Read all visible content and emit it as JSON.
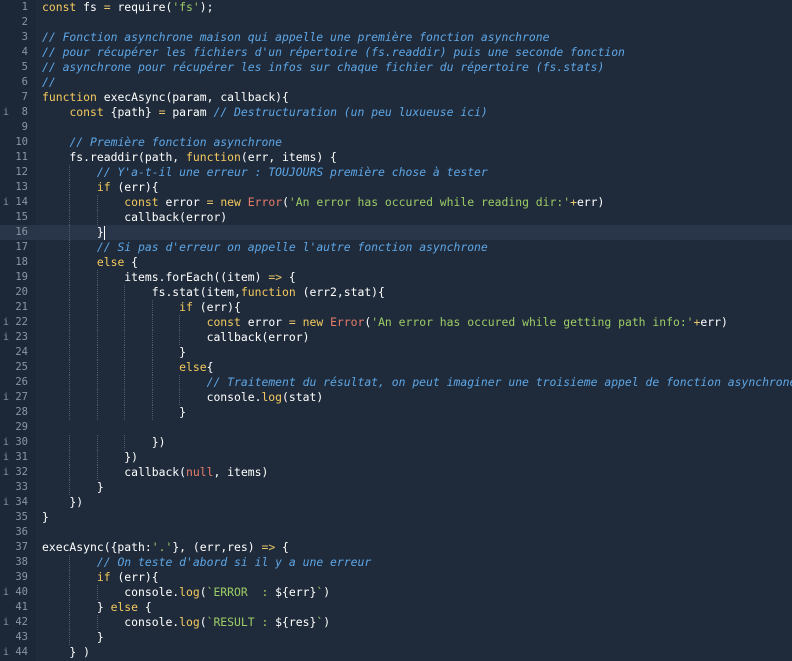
{
  "editor": {
    "active_line": 16,
    "lines": [
      {
        "n": "1",
        "m": "",
        "tokens": [
          {
            "t": "kw",
            "v": "const"
          },
          {
            "t": "plain",
            "v": " fs "
          },
          {
            "t": "op",
            "v": "="
          },
          {
            "t": "plain",
            "v": " require("
          },
          {
            "t": "str",
            "v": "'fs'"
          },
          {
            "t": "plain",
            "v": ");"
          }
        ]
      },
      {
        "n": "2",
        "m": "",
        "tokens": []
      },
      {
        "n": "3",
        "m": "",
        "tokens": [
          {
            "t": "cmt",
            "v": "// Fonction asynchrone maison qui appelle une première fonction asynchrone"
          }
        ]
      },
      {
        "n": "4",
        "m": "",
        "tokens": [
          {
            "t": "cmt",
            "v": "// pour récupérer les fichiers d'un répertoire (fs.readdir) puis une seconde fonction"
          }
        ]
      },
      {
        "n": "5",
        "m": "",
        "tokens": [
          {
            "t": "cmt",
            "v": "// asynchrone pour récupérer les infos sur chaque fichier du répertoire (fs.stats)"
          }
        ]
      },
      {
        "n": "6",
        "m": "",
        "tokens": [
          {
            "t": "cmt",
            "v": "//"
          }
        ]
      },
      {
        "n": "7",
        "m": "",
        "tokens": [
          {
            "t": "kw",
            "v": "function"
          },
          {
            "t": "plain",
            "v": " execAsync(param, callback){"
          }
        ]
      },
      {
        "n": "8",
        "m": "i",
        "tokens": [
          {
            "t": "plain",
            "v": "    "
          },
          {
            "t": "kw",
            "v": "const"
          },
          {
            "t": "plain",
            "v": " {path} "
          },
          {
            "t": "op",
            "v": "="
          },
          {
            "t": "plain",
            "v": " param "
          },
          {
            "t": "cmt",
            "v": "// Destructuration (un peu luxueuse ici)"
          }
        ]
      },
      {
        "n": "9",
        "m": "",
        "tokens": []
      },
      {
        "n": "10",
        "m": "",
        "tokens": [
          {
            "t": "plain",
            "v": "    "
          },
          {
            "t": "cmt",
            "v": "// Première fonction asynchrone"
          }
        ]
      },
      {
        "n": "11",
        "m": "",
        "tokens": [
          {
            "t": "plain",
            "v": "    fs.readdir(path, "
          },
          {
            "t": "kw",
            "v": "function"
          },
          {
            "t": "plain",
            "v": "(err, items) {"
          }
        ]
      },
      {
        "n": "12",
        "m": "",
        "tokens": [
          {
            "t": "plain",
            "v": "        "
          },
          {
            "t": "cmt",
            "v": "// Y'a-t-il une erreur : TOUJOURS première chose à tester"
          }
        ]
      },
      {
        "n": "13",
        "m": "",
        "tokens": [
          {
            "t": "plain",
            "v": "        "
          },
          {
            "t": "kw",
            "v": "if"
          },
          {
            "t": "plain",
            "v": " (err){"
          }
        ]
      },
      {
        "n": "14",
        "m": "i",
        "tokens": [
          {
            "t": "plain",
            "v": "            "
          },
          {
            "t": "kw",
            "v": "const"
          },
          {
            "t": "plain",
            "v": " error "
          },
          {
            "t": "op",
            "v": "="
          },
          {
            "t": "plain",
            "v": " "
          },
          {
            "t": "kw",
            "v": "new"
          },
          {
            "t": "plain",
            "v": " "
          },
          {
            "t": "cls",
            "v": "Error"
          },
          {
            "t": "plain",
            "v": "("
          },
          {
            "t": "str",
            "v": "'An error has occured while reading dir:'"
          },
          {
            "t": "op",
            "v": "+"
          },
          {
            "t": "plain",
            "v": "err)"
          }
        ]
      },
      {
        "n": "15",
        "m": "",
        "tokens": [
          {
            "t": "plain",
            "v": "            callback(error)"
          }
        ]
      },
      {
        "n": "16",
        "m": "",
        "tokens": [
          {
            "t": "plain",
            "v": "        }"
          }
        ]
      },
      {
        "n": "17",
        "m": "",
        "tokens": [
          {
            "t": "plain",
            "v": "        "
          },
          {
            "t": "cmt",
            "v": "// Si pas d'erreur on appelle l'autre fonction asynchrone"
          }
        ]
      },
      {
        "n": "18",
        "m": "",
        "tokens": [
          {
            "t": "plain",
            "v": "        "
          },
          {
            "t": "kw",
            "v": "else"
          },
          {
            "t": "plain",
            "v": " {"
          }
        ]
      },
      {
        "n": "19",
        "m": "",
        "tokens": [
          {
            "t": "plain",
            "v": "            items.forEach((item) "
          },
          {
            "t": "op",
            "v": "=>"
          },
          {
            "t": "plain",
            "v": " {"
          }
        ]
      },
      {
        "n": "20",
        "m": "",
        "tokens": [
          {
            "t": "plain",
            "v": "                fs.stat(item,"
          },
          {
            "t": "kw",
            "v": "function"
          },
          {
            "t": "plain",
            "v": " (err2,stat){"
          }
        ]
      },
      {
        "n": "21",
        "m": "",
        "tokens": [
          {
            "t": "plain",
            "v": "                    "
          },
          {
            "t": "kw",
            "v": "if"
          },
          {
            "t": "plain",
            "v": " (err){"
          }
        ]
      },
      {
        "n": "22",
        "m": "i",
        "tokens": [
          {
            "t": "plain",
            "v": "                        "
          },
          {
            "t": "kw",
            "v": "const"
          },
          {
            "t": "plain",
            "v": " error "
          },
          {
            "t": "op",
            "v": "="
          },
          {
            "t": "plain",
            "v": " "
          },
          {
            "t": "kw",
            "v": "new"
          },
          {
            "t": "plain",
            "v": " "
          },
          {
            "t": "cls",
            "v": "Error"
          },
          {
            "t": "plain",
            "v": "("
          },
          {
            "t": "str",
            "v": "'An error has occured while getting path info:'"
          },
          {
            "t": "op",
            "v": "+"
          },
          {
            "t": "plain",
            "v": "err)"
          }
        ]
      },
      {
        "n": "23",
        "m": "i",
        "tokens": [
          {
            "t": "plain",
            "v": "                        callback(error)"
          }
        ]
      },
      {
        "n": "24",
        "m": "",
        "tokens": [
          {
            "t": "plain",
            "v": "                    }"
          }
        ]
      },
      {
        "n": "25",
        "m": "",
        "tokens": [
          {
            "t": "plain",
            "v": "                    "
          },
          {
            "t": "kw",
            "v": "else"
          },
          {
            "t": "plain",
            "v": "{"
          }
        ]
      },
      {
        "n": "26",
        "m": "",
        "tokens": [
          {
            "t": "plain",
            "v": "                        "
          },
          {
            "t": "cmt",
            "v": "// Traitement du résultat, on peut imaginer une troisieme appel de fonction asynchrone"
          }
        ]
      },
      {
        "n": "27",
        "m": "i",
        "tokens": [
          {
            "t": "plain",
            "v": "                        console."
          },
          {
            "t": "kw",
            "v": "log"
          },
          {
            "t": "plain",
            "v": "(stat)"
          }
        ]
      },
      {
        "n": "28",
        "m": "",
        "tokens": [
          {
            "t": "plain",
            "v": "                    }"
          }
        ]
      },
      {
        "n": "29",
        "m": "",
        "tokens": []
      },
      {
        "n": "30",
        "m": "i",
        "tokens": [
          {
            "t": "plain",
            "v": "                })"
          }
        ]
      },
      {
        "n": "31",
        "m": "i",
        "tokens": [
          {
            "t": "plain",
            "v": "            })"
          }
        ]
      },
      {
        "n": "32",
        "m": "i",
        "tokens": [
          {
            "t": "plain",
            "v": "            callback("
          },
          {
            "t": "cls",
            "v": "null"
          },
          {
            "t": "plain",
            "v": ", items)"
          }
        ]
      },
      {
        "n": "33",
        "m": "",
        "tokens": [
          {
            "t": "plain",
            "v": "        }"
          }
        ]
      },
      {
        "n": "34",
        "m": "i",
        "tokens": [
          {
            "t": "plain",
            "v": "    })"
          }
        ]
      },
      {
        "n": "35",
        "m": "",
        "tokens": [
          {
            "t": "plain",
            "v": "}"
          }
        ]
      },
      {
        "n": "36",
        "m": "",
        "tokens": []
      },
      {
        "n": "37",
        "m": "",
        "tokens": [
          {
            "t": "plain",
            "v": "execAsync({path:"
          },
          {
            "t": "str",
            "v": "'.'"
          },
          {
            "t": "plain",
            "v": "}, (err,res) "
          },
          {
            "t": "op",
            "v": "=>"
          },
          {
            "t": "plain",
            "v": " {"
          }
        ]
      },
      {
        "n": "38",
        "m": "",
        "tokens": [
          {
            "t": "plain",
            "v": "        "
          },
          {
            "t": "cmt",
            "v": "// On teste d'abord si il y a une erreur"
          }
        ]
      },
      {
        "n": "39",
        "m": "",
        "tokens": [
          {
            "t": "plain",
            "v": "        "
          },
          {
            "t": "kw",
            "v": "if"
          },
          {
            "t": "plain",
            "v": " (err){"
          }
        ]
      },
      {
        "n": "40",
        "m": "i",
        "tokens": [
          {
            "t": "plain",
            "v": "            console."
          },
          {
            "t": "kw",
            "v": "log"
          },
          {
            "t": "plain",
            "v": "("
          },
          {
            "t": "str",
            "v": "`ERROR  : "
          },
          {
            "t": "plain",
            "v": "${err}"
          },
          {
            "t": "str",
            "v": "`"
          },
          {
            "t": "plain",
            "v": ")"
          }
        ]
      },
      {
        "n": "41",
        "m": "",
        "tokens": [
          {
            "t": "plain",
            "v": "        } "
          },
          {
            "t": "kw",
            "v": "else"
          },
          {
            "t": "plain",
            "v": " {"
          }
        ]
      },
      {
        "n": "42",
        "m": "i",
        "tokens": [
          {
            "t": "plain",
            "v": "            console."
          },
          {
            "t": "kw",
            "v": "log"
          },
          {
            "t": "plain",
            "v": "("
          },
          {
            "t": "str",
            "v": "`RESULT : "
          },
          {
            "t": "plain",
            "v": "${res}"
          },
          {
            "t": "str",
            "v": "`"
          },
          {
            "t": "plain",
            "v": ")"
          }
        ]
      },
      {
        "n": "43",
        "m": "",
        "tokens": [
          {
            "t": "plain",
            "v": "        }"
          }
        ]
      },
      {
        "n": "44",
        "m": "i",
        "tokens": [
          {
            "t": "plain",
            "v": "    } )"
          }
        ]
      }
    ]
  }
}
